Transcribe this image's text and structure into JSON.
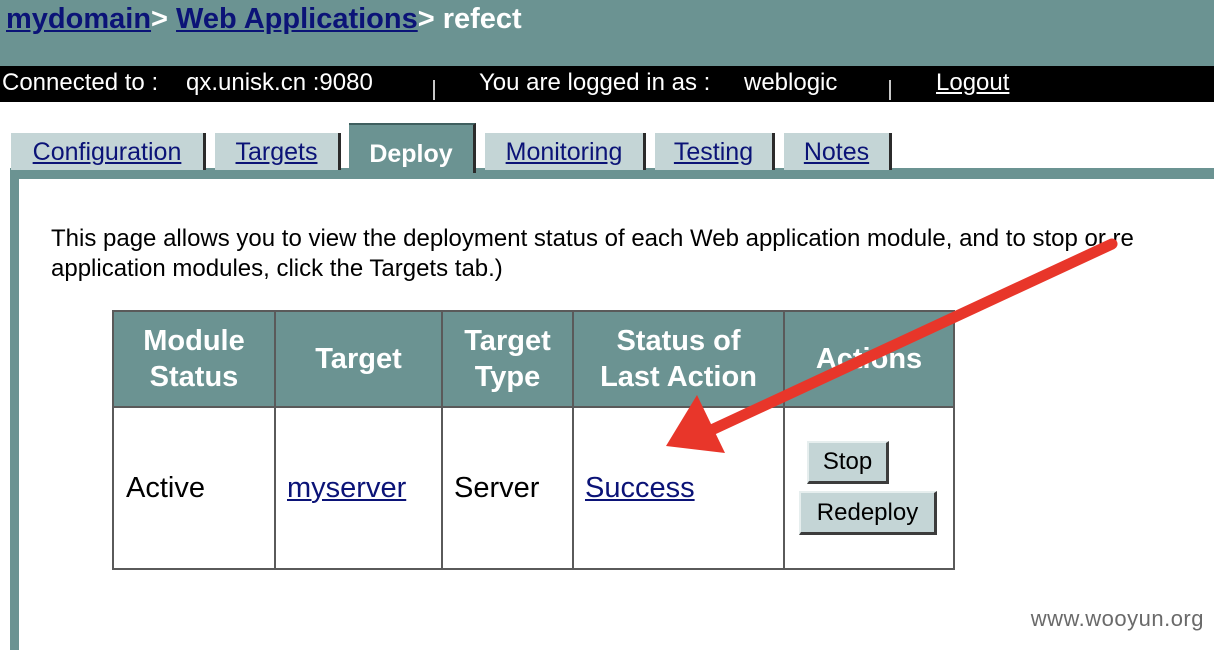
{
  "breadcrumb": {
    "domain": "mydomain",
    "sep1": ">",
    "section": "Web Applications",
    "sep2": ">",
    "current": "refect"
  },
  "connection": {
    "connected_label": "Connected to :",
    "host": "qx.unisk.cn :9080",
    "logged_in_label": "You are logged in as :",
    "user": "weblogic",
    "logout": "Logout"
  },
  "tabs": [
    {
      "label": "Configuration",
      "active": false
    },
    {
      "label": "Targets",
      "active": false
    },
    {
      "label": "Deploy",
      "active": true
    },
    {
      "label": "Monitoring",
      "active": false
    },
    {
      "label": "Testing",
      "active": false
    },
    {
      "label": "Notes",
      "active": false
    }
  ],
  "description": {
    "line1": "This page allows you to view the deployment status of each Web application module, and to stop or re",
    "line2": "application modules, click the Targets tab.)"
  },
  "table": {
    "headers": {
      "module_status": "Module\nStatus",
      "target": "Target",
      "target_type": "Target\nType",
      "status_last_action": "Status of\nLast Action",
      "actions": "Actions"
    },
    "rows": [
      {
        "module_status": "Active",
        "target": "myserver",
        "target_type": "Server",
        "status_last_action": "Success",
        "stop_label": "Stop",
        "redeploy_label": "Redeploy"
      }
    ]
  },
  "watermark": "www.wooyun.org",
  "colors": {
    "header_teal": "#6b9392",
    "tab_inactive": "#c4d5d6",
    "link_blue": "#0b1377",
    "arrow_red": "#e8362a"
  },
  "annotation": {
    "type": "arrow",
    "points_to": "status-of-last-action-cell"
  }
}
